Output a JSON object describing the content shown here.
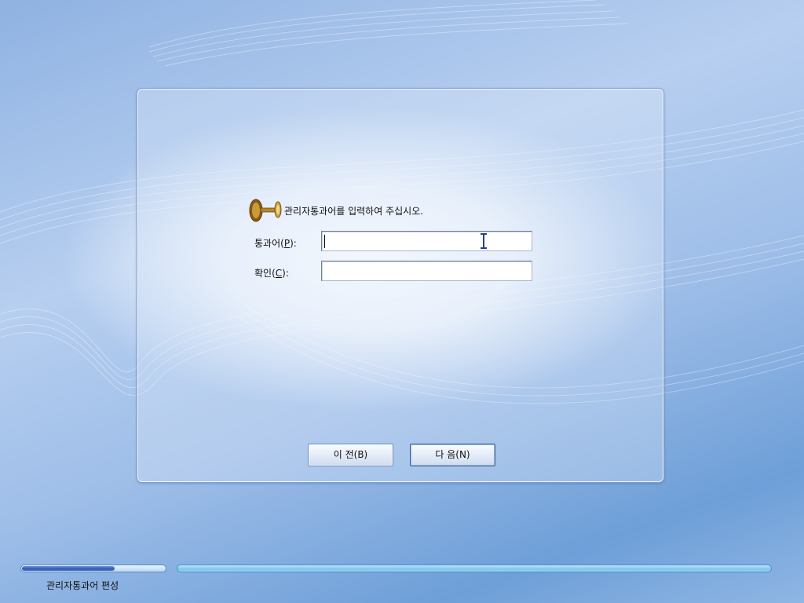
{
  "dialog": {
    "prompt": "관리자통과어를 입력하여 주십시오.",
    "key_icon": "key-icon"
  },
  "fields": {
    "password": {
      "label": "통과어(",
      "mnemonic": "P",
      "label_suffix": "):",
      "value": ""
    },
    "confirm": {
      "label": "확인(",
      "mnemonic": "C",
      "label_suffix": "):",
      "value": ""
    }
  },
  "buttons": {
    "prev": "이 전(B)",
    "next": "다 음(N)"
  },
  "status": {
    "step_label": "관리자통과어 편성",
    "step_progress": 0.65
  },
  "colors": {
    "progress_fill": "#3458b0",
    "progress_track": "#7fc4ee"
  }
}
